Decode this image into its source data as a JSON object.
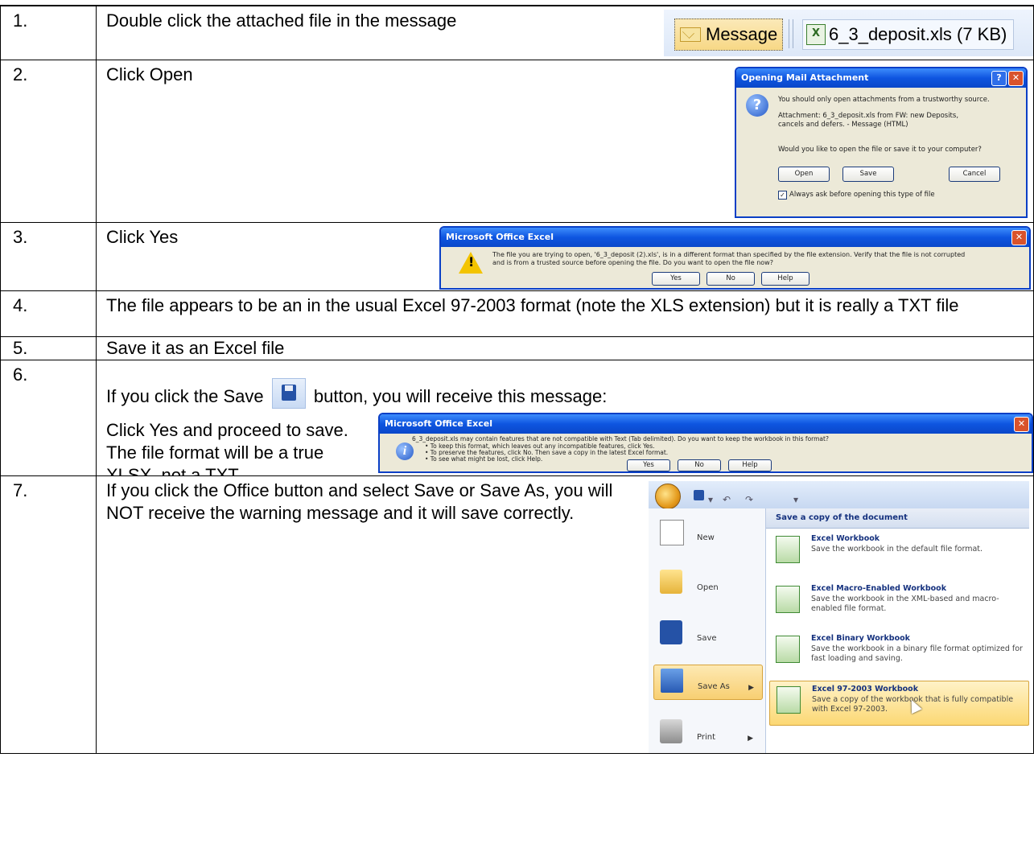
{
  "steps": [
    {
      "num": "1.",
      "text": "Double click the attached file in the message"
    },
    {
      "num": "2.",
      "text": "Click Open"
    },
    {
      "num": "3.",
      "text": "Click Yes"
    },
    {
      "num": "4.",
      "text": "The file appears to be an in the usual Excel 97-2003 format (note the XLS extension) but it is really a TXT file"
    },
    {
      "num": "5.",
      "text": "Save it as an Excel file"
    },
    {
      "num": "6.",
      "text_before": "If you click the Save",
      "text_after": "button, you will receive this message:",
      "note_line1": "Click Yes and proceed to save.",
      "note_line2": "The file format will be a true",
      "note_line3": "XLSX, not a TXT."
    },
    {
      "num": "7.",
      "text": "If you click the Office button and select Save or Save As, you will NOT receive the warning message and it will save correctly."
    }
  ],
  "message_bar": {
    "tab_label": "Message",
    "attachment": "6_3_deposit.xls (7 KB)",
    "xls_glyph": "X"
  },
  "open_dialog": {
    "title": "Opening Mail Attachment",
    "warning": "You should only open attachments from a trustworthy source.",
    "attachment_line1": "Attachment: 6_3_deposit.xls from FW: new Deposits,",
    "attachment_line2": "cancels and defers. - Message (HTML)",
    "question": "Would you like to open the file or save it to your computer?",
    "open_label": "Open",
    "save_label": "Save",
    "cancel_label": "Cancel",
    "checkbox_label": "Always ask before opening this type of file"
  },
  "excel_format_dialog": {
    "title": "Microsoft Office Excel",
    "line1": "The file you are trying to open, '6_3_deposit (2).xls', is in a different format than specified by the file extension. Verify that the file is not corrupted",
    "line2": "and is from a trusted source before opening the file. Do you want to open the file now?",
    "yes_label": "Yes",
    "no_label": "No",
    "help_label": "Help"
  },
  "excel_compat_dialog": {
    "title": "Microsoft Office Excel",
    "line1": "6_3_deposit.xls may contain features that are not compatible with Text (Tab delimited). Do you want to keep the workbook in this format?",
    "bullet1": "• To keep this format, which leaves out any incompatible features, click Yes.",
    "bullet2": "• To preserve the features, click No. Then save a copy in the latest Excel format.",
    "bullet3": "• To see what might be lost, click Help.",
    "yes_label": "Yes",
    "no_label": "No",
    "help_label": "Help"
  },
  "office_menu": {
    "qat_items": [
      "▾",
      "↶",
      "↷",
      "▾"
    ],
    "left_items": [
      {
        "label": "New"
      },
      {
        "label": "Open"
      },
      {
        "label": "Save"
      },
      {
        "label": "Save As"
      },
      {
        "label": "Print"
      }
    ],
    "right_header": "Save a copy of the document",
    "right_items": [
      {
        "title": "Excel Workbook",
        "desc": "Save the workbook in the default file format."
      },
      {
        "title": "Excel Macro-Enabled Workbook",
        "desc": "Save the workbook in the XML-based and macro-enabled file format."
      },
      {
        "title": "Excel Binary Workbook",
        "desc": "Save the workbook in a binary file format optimized for fast loading and saving."
      },
      {
        "title": "Excel 97-2003 Workbook",
        "desc": "Save a copy of the workbook that is fully compatible with Excel 97-2003."
      }
    ]
  }
}
